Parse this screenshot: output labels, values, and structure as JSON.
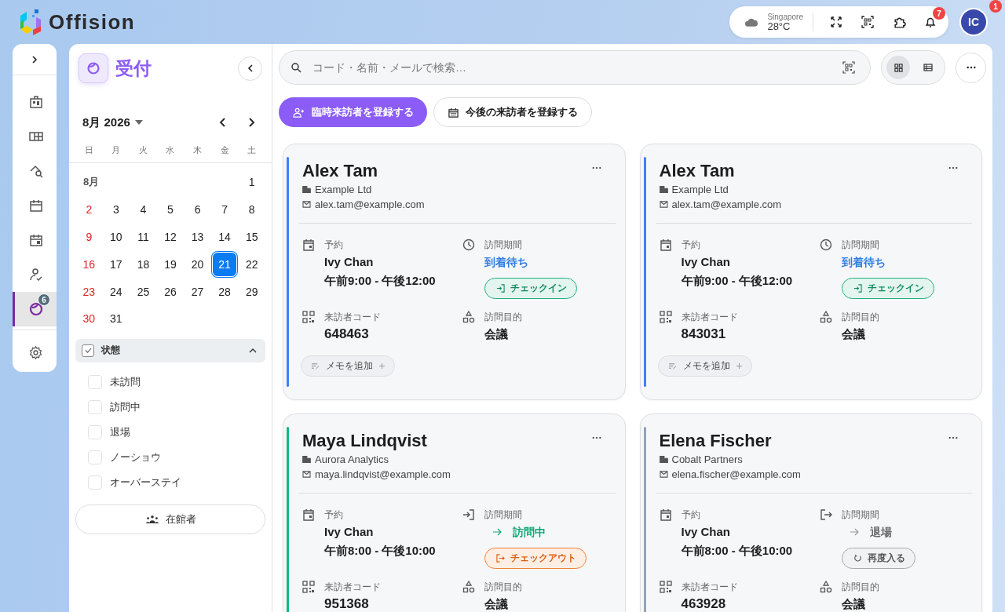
{
  "app": {
    "logo_text": "Offision"
  },
  "top_bar": {
    "weather": {
      "city": "Singapore",
      "temperature": "28°C"
    },
    "notifications_badge": "7",
    "avatar": {
      "initials": "IC",
      "badge": "1"
    }
  },
  "rail": {
    "items": [
      {
        "kind": "dashboard",
        "selected": false
      },
      {
        "kind": "rooms",
        "selected": false
      },
      {
        "kind": "search",
        "selected": false
      },
      {
        "kind": "calendar",
        "selected": false
      },
      {
        "kind": "event",
        "selected": false
      },
      {
        "kind": "approval",
        "selected": false
      },
      {
        "kind": "reception",
        "selected": true,
        "badge": "6"
      }
    ]
  },
  "side_panel": {
    "title": "受付",
    "calendar": {
      "month_label": "8月 2026",
      "weekdays": [
        "日",
        "月",
        "火",
        "水",
        "木",
        "金",
        "土"
      ],
      "row_label": "8月",
      "days": [
        {
          "day": "1",
          "selected": false
        },
        {
          "day": "2",
          "selected": false
        },
        {
          "day": "3",
          "selected": false
        },
        {
          "day": "4",
          "selected": false
        },
        {
          "day": "5",
          "selected": false
        },
        {
          "day": "6",
          "selected": false
        },
        {
          "day": "7",
          "selected": false
        },
        {
          "day": "8",
          "selected": false
        },
        {
          "day": "9",
          "selected": false
        },
        {
          "day": "10",
          "selected": false
        },
        {
          "day": "11",
          "selected": false
        },
        {
          "day": "12",
          "selected": false
        },
        {
          "day": "13",
          "selected": false
        },
        {
          "day": "14",
          "selected": false
        },
        {
          "day": "15",
          "selected": false
        },
        {
          "day": "16",
          "selected": false
        },
        {
          "day": "17",
          "selected": false
        },
        {
          "day": "18",
          "selected": false
        },
        {
          "day": "19",
          "selected": false
        },
        {
          "day": "20",
          "selected": false
        },
        {
          "day": "21",
          "selected": true
        },
        {
          "day": "22",
          "selected": false
        },
        {
          "day": "23",
          "selected": false
        },
        {
          "day": "24",
          "selected": false
        },
        {
          "day": "25",
          "selected": false
        },
        {
          "day": "26",
          "selected": false
        },
        {
          "day": "27",
          "selected": false
        },
        {
          "day": "28",
          "selected": false
        },
        {
          "day": "29",
          "selected": false
        },
        {
          "day": "30",
          "selected": false
        },
        {
          "day": "31",
          "selected": false
        }
      ]
    },
    "filter": {
      "label": "状態",
      "checked": true,
      "expanded": true,
      "options": [
        {
          "label": "未訪問",
          "checked": false
        },
        {
          "label": "訪問中",
          "checked": false
        },
        {
          "label": "退場",
          "checked": false
        },
        {
          "label": "ノーショウ",
          "checked": false
        },
        {
          "label": "オーバーステイ",
          "checked": false
        }
      ]
    },
    "onsite_button": "在館者"
  },
  "search": {
    "placeholder": "コード・名前・メールで検索…"
  },
  "view_toggle": [
    {
      "kind": "grid",
      "selected": true
    },
    {
      "kind": "list",
      "selected": false
    }
  ],
  "actions": [
    {
      "kind": "primary",
      "label": "臨時来訪者を登録する"
    },
    {
      "kind": "secondary",
      "label": "今後の来訪者を登録する"
    }
  ],
  "visitors": [
    {
      "name": "Alex Tam",
      "company": "Example Ltd",
      "email": "alex.tam@example.com",
      "color": "#3b82f6",
      "kind": "waiting",
      "reservation_label": "予約",
      "host": "Ivy Chan",
      "time": "午前9:00 - 午後12:00",
      "period_label": "訪問期間",
      "status": "到着待ち",
      "action": "チェックイン",
      "code_label": "来訪者コード",
      "code": "648463",
      "purpose_label": "訪問目的",
      "purpose": "会議",
      "memo_button": "メモを追加"
    },
    {
      "name": "Alex Tam",
      "company": "Example Ltd",
      "email": "alex.tam@example.com",
      "color": "#3b82f6",
      "kind": "waiting",
      "reservation_label": "予約",
      "host": "Ivy Chan",
      "time": "午前9:00 - 午後12:00",
      "period_label": "訪問期間",
      "status": "到着待ち",
      "action": "チェックイン",
      "code_label": "来訪者コード",
      "code": "843031",
      "purpose_label": "訪問目的",
      "purpose": "会議",
      "memo_button": "メモを追加"
    },
    {
      "name": "Maya Lindqvist",
      "company": "Aurora Analytics",
      "email": "maya.lindqvist@example.com",
      "color": "#10b981",
      "kind": "visiting",
      "reservation_label": "予約",
      "host": "Ivy Chan",
      "time": "午前8:00 - 午後10:00",
      "period_label": "訪問期間",
      "status": "訪問中",
      "action": "チェックアウト",
      "code_label": "来訪者コード",
      "code": "951368",
      "purpose_label": "訪問目的",
      "purpose": "会議"
    },
    {
      "name": "Elena Fischer",
      "company": "Cobalt Partners",
      "email": "elena.fischer@example.com",
      "color": "#94a3b8",
      "kind": "left",
      "reservation_label": "予約",
      "host": "Ivy Chan",
      "time": "午前8:00 - 午後10:00",
      "period_label": "訪問期間",
      "status": "退場",
      "action": "再度入る",
      "code_label": "来訪者コード",
      "code": "463928",
      "purpose_label": "訪問目的",
      "purpose": "会議"
    }
  ]
}
